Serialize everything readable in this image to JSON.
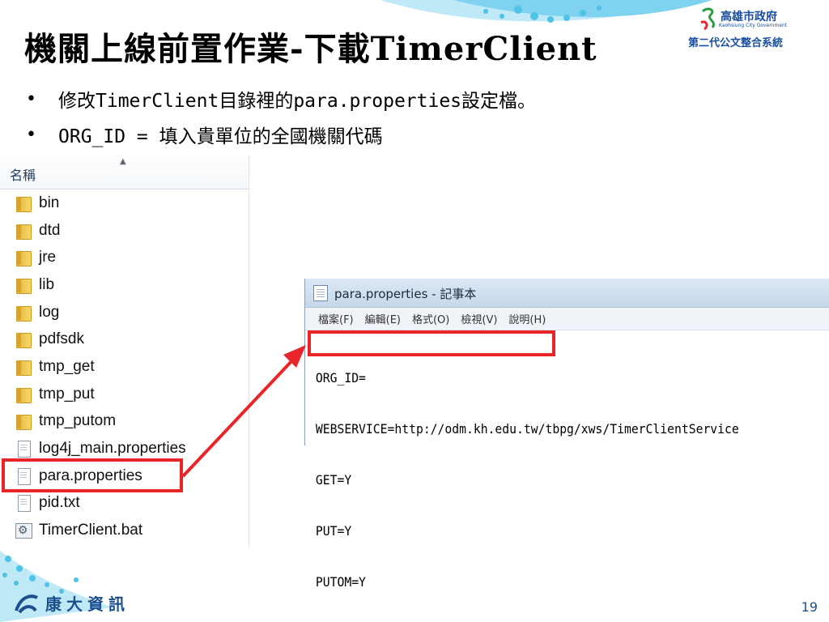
{
  "slide": {
    "title": "機關上線前置作業-下載TimerClient",
    "bullets": [
      "修改TimerClient目錄裡的para.properties設定檔。",
      "ORG_ID = 填入貴單位的全國機關代碼"
    ],
    "page_number": "19"
  },
  "logos": {
    "gov_name": "高雄市政府",
    "gov_name_en": "Kaohsiung City Government",
    "gov_system": "第二代公文整合系統",
    "company": "康大資訊"
  },
  "explorer": {
    "column_header": "名稱",
    "items": [
      {
        "name": "bin",
        "icon": "folder-icon"
      },
      {
        "name": "dtd",
        "icon": "folder-icon"
      },
      {
        "name": "jre",
        "icon": "folder-icon"
      },
      {
        "name": "lib",
        "icon": "folder-icon"
      },
      {
        "name": "log",
        "icon": "folder-icon"
      },
      {
        "name": "pdfsdk",
        "icon": "folder-icon"
      },
      {
        "name": "tmp_get",
        "icon": "folder-icon"
      },
      {
        "name": "tmp_put",
        "icon": "folder-icon"
      },
      {
        "name": "tmp_putom",
        "icon": "folder-icon"
      },
      {
        "name": "log4j_main.properties",
        "icon": "document-icon"
      },
      {
        "name": "para.properties",
        "icon": "document-icon",
        "highlighted": true
      },
      {
        "name": "pid.txt",
        "icon": "document-icon"
      },
      {
        "name": "TimerClient.bat",
        "icon": "batch-file-icon"
      }
    ]
  },
  "notepad": {
    "title": "para.properties - 記事本",
    "menus": [
      "檔案(F)",
      "編輯(E)",
      "格式(O)",
      "檢視(V)",
      "說明(H)"
    ],
    "lines": [
      "ORG_ID=",
      "WEBSERVICE=http://odm.kh.edu.tw/tbpg/xws/TimerClientService",
      "GET=Y",
      "PUT=Y",
      "PUTOM=Y"
    ]
  },
  "colors": {
    "highlight": "#e8262a",
    "brand_blue": "#1b4f8e",
    "wave_cyan": "#4ec3e8"
  }
}
